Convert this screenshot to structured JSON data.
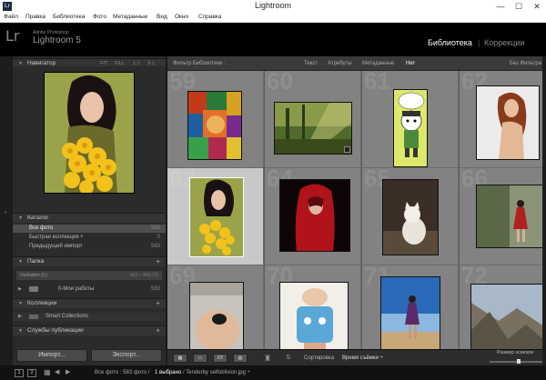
{
  "window": {
    "title": "Lightroom",
    "app_icon": "Lr",
    "minimize": "—",
    "maximize": "☐",
    "close": "✕"
  },
  "menu": [
    "Файл",
    "Правка",
    "Библиотека",
    "Фото",
    "Метаданные",
    "Вид",
    "Окно",
    "Справка"
  ],
  "identity": {
    "logo": "Lr",
    "vendor": "Adobe Photoshop",
    "product": "Lightroom 5"
  },
  "modules": [
    "Библиотека",
    "Коррекции"
  ],
  "navigator": {
    "title": "Навигатор",
    "zoom": [
      "FIT",
      "FILL",
      "1:1",
      "3:1"
    ]
  },
  "catalog": {
    "title": "Каталог",
    "items": [
      {
        "label": "Все фото",
        "count": "583"
      },
      {
        "label": "Быстрая коллекция +",
        "count": "0"
      },
      {
        "label": "Предыдущий импорт",
        "count": "583"
      }
    ]
  },
  "folders": {
    "title": "Папка",
    "volume": {
      "label": "Verbatim (I:)",
      "info": "461 / 466 ГБ"
    },
    "items": [
      {
        "label": "0-Мои работы",
        "count": "583"
      }
    ]
  },
  "collections": {
    "title": "Коллекции",
    "items": [
      "Smart Collections"
    ]
  },
  "publish": {
    "title": "Службы публикации"
  },
  "buttons": {
    "import": "Импорт...",
    "export": "Экспорт..."
  },
  "filterbar": {
    "title": "Фильтр Библиотеки :",
    "options": [
      "Текст",
      "Атрибуты",
      "Метаданные",
      "Нет"
    ],
    "preset": "Без Фильтра ÷"
  },
  "grid": {
    "cell_numbers": [
      "59",
      "60",
      "61",
      "62",
      "63",
      "64",
      "65",
      "66",
      "69",
      "70",
      "71",
      "72"
    ],
    "selected_cell": 4
  },
  "toolbar": {
    "sort_label": "Сортировка",
    "sort_value": "Время съёмки ÷",
    "thumb_label": "Размер эскизов",
    "view_icons": [
      "▦",
      "▭",
      "XY",
      "▤"
    ],
    "thumb_size": 0.55
  },
  "filmstrip": {
    "pages": [
      "1",
      "2"
    ],
    "status_all": "Все фото : 583 фото /",
    "status_sel": "1 выбрано",
    "status_file": "/ Tenderby selfoblivion.jpg ÷"
  },
  "colors": {
    "accent": "#ffffff",
    "panel": "#2b2b2b",
    "grid_bg": "#828282",
    "grid_selected": "#c8c8c8"
  }
}
